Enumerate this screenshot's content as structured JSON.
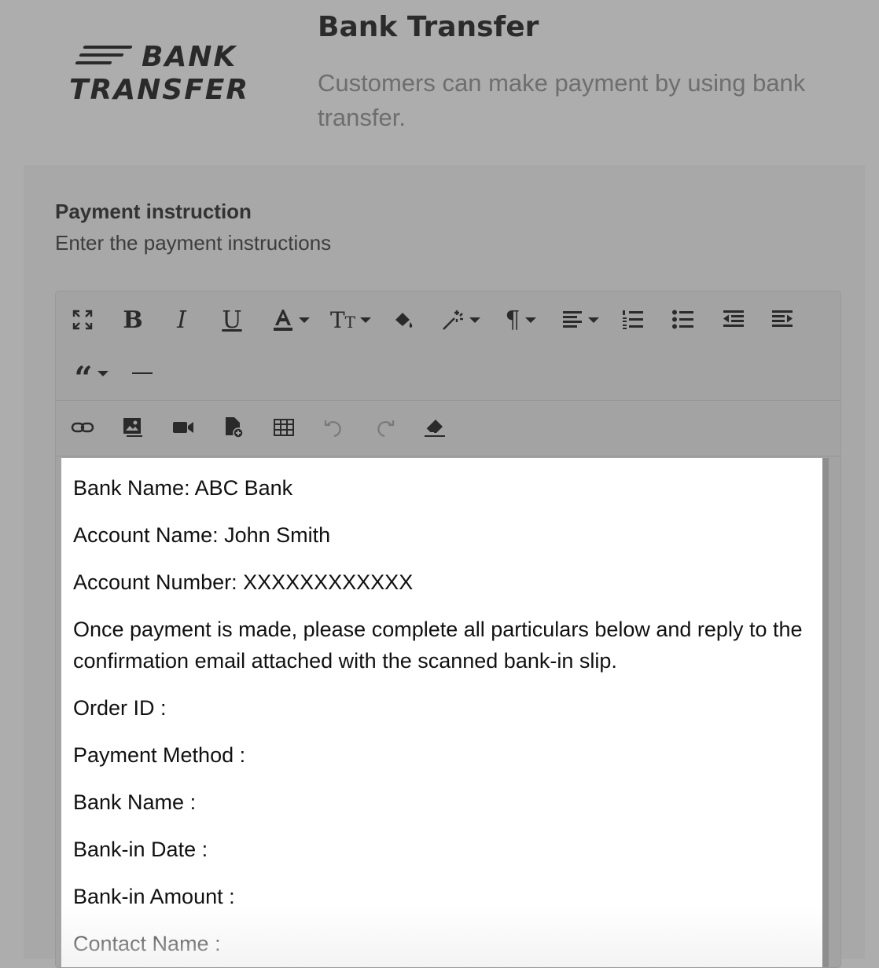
{
  "logo": {
    "line1": "BANK",
    "line2": "TRANSFER"
  },
  "header": {
    "title": "Bank Transfer",
    "subtitle": "Customers can make payment by using bank transfer."
  },
  "field": {
    "label": "Payment instruction",
    "help": "Enter the payment instructions"
  },
  "toolbar": {
    "row1": [
      "fullscreen-icon",
      "bold-icon",
      "italic-icon",
      "underline-icon",
      "font-color-icon",
      "font-size-icon",
      "fill-color-icon",
      "magic-style-icon",
      "paragraph-icon",
      "align-icon",
      "ordered-list-icon",
      "unordered-list-icon",
      "outdent-icon",
      "indent-icon",
      "blockquote-icon",
      "horizontal-rule-icon"
    ],
    "row2": [
      "link-icon",
      "image-icon",
      "video-icon",
      "file-icon",
      "table-icon",
      "undo-icon",
      "redo-icon",
      "clear-format-icon"
    ]
  },
  "content": {
    "lines": [
      "Bank Name: ABC Bank",
      "Account Name: John Smith",
      "Account Number: XXXXXXXXXXXX",
      "Once payment is made, please complete all particulars below and reply to the confirmation email attached with the scanned bank-in slip.",
      "Order ID :",
      "Payment Method :",
      "Bank Name :",
      "Bank-in Date :",
      "Bank-in Amount :",
      "Contact Name :"
    ]
  }
}
